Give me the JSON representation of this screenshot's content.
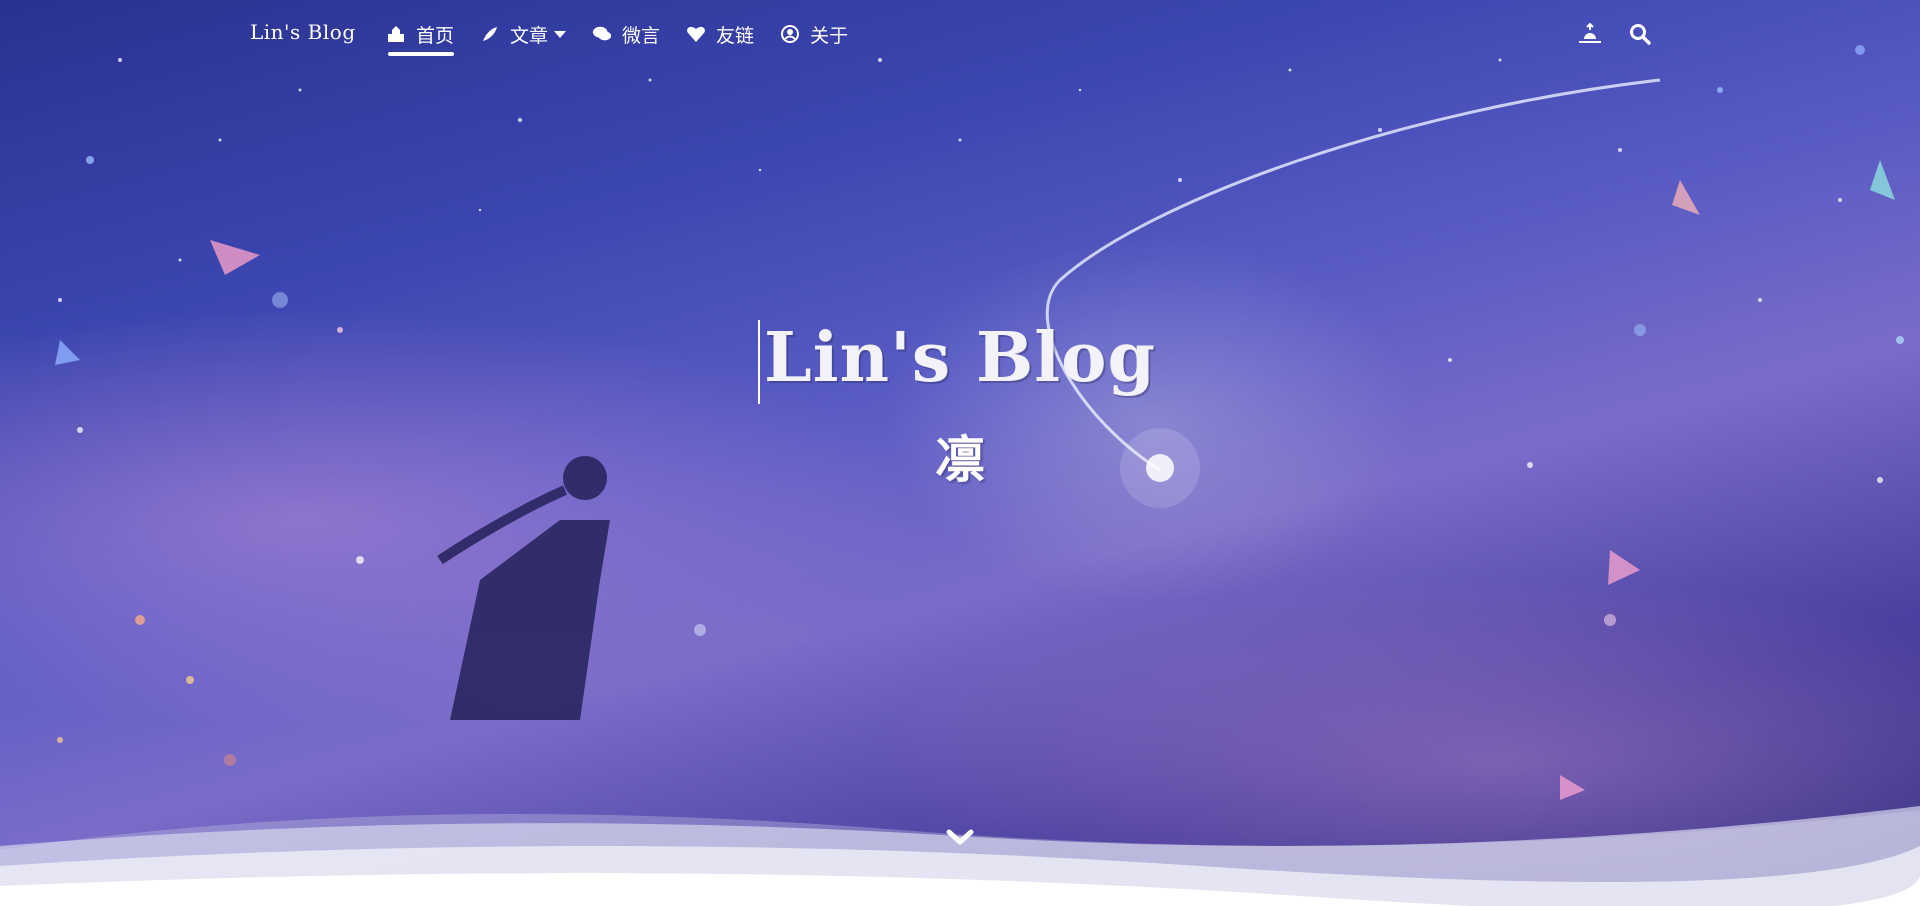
{
  "navbar": {
    "brand": "Lin's Blog",
    "items": [
      {
        "label": "首页",
        "icon": "home-icon",
        "active": true
      },
      {
        "label": "文章",
        "icon": "feather-icon",
        "dropdown": true
      },
      {
        "label": "微言",
        "icon": "comments-icon"
      },
      {
        "label": "友链",
        "icon": "heart-icon"
      },
      {
        "label": "关于",
        "icon": "user-circle-icon"
      }
    ],
    "right_icons": [
      "theme-toggle-icon",
      "search-icon"
    ]
  },
  "hero": {
    "title": "Lin's Blog",
    "subtitle": "凛",
    "scroll_icon": "chevron-down-icon"
  },
  "colors": {
    "sky_top": "#2a3290",
    "sky_mid": "#5a5cc4",
    "text": "#ffffff"
  }
}
